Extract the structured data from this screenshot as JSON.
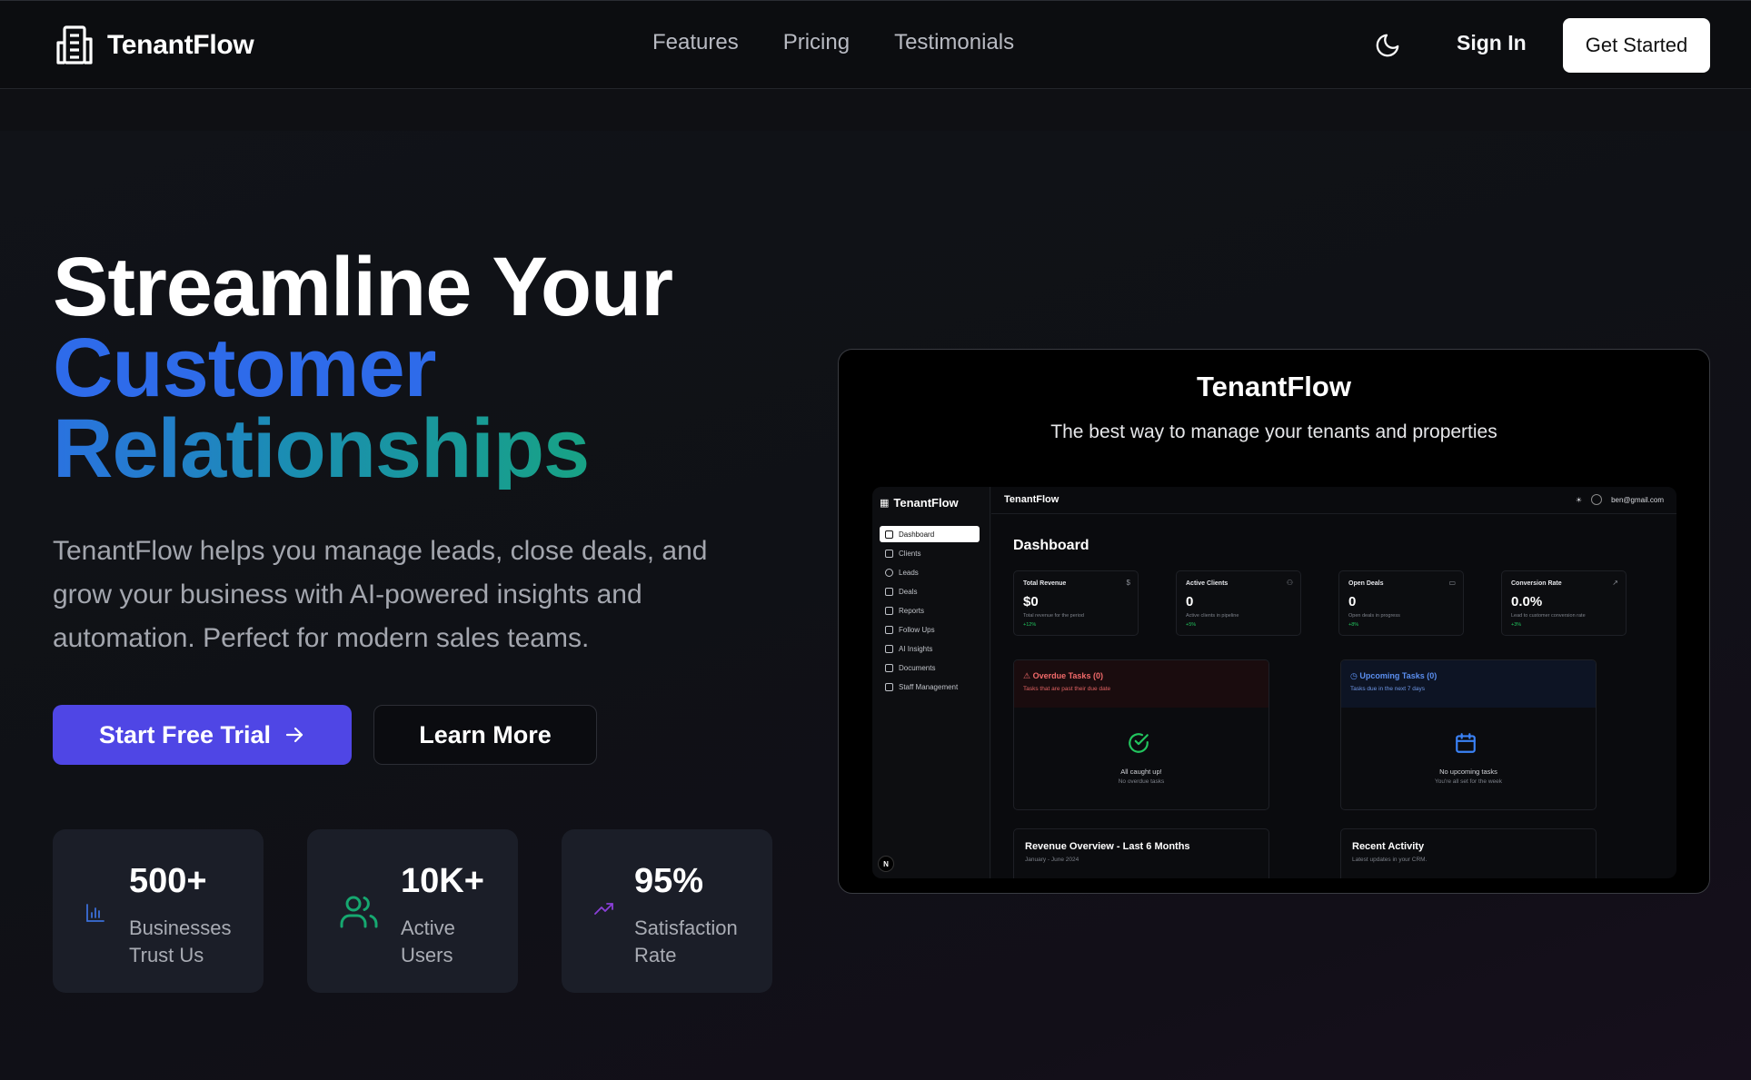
{
  "nav": {
    "brand": "TenantFlow",
    "links": [
      "Features",
      "Pricing",
      "Testimonials"
    ],
    "sign_in": "Sign In",
    "get_started": "Get Started"
  },
  "hero": {
    "headline_line1": "Streamline Your",
    "headline_line2": "Customer",
    "headline_line3": "Relationships",
    "lead": "TenantFlow helps you manage leads, close deals, and grow your business with AI-powered insights and automation. Perfect for modern sales teams.",
    "primary_cta": "Start Free Trial",
    "secondary_cta": "Learn More"
  },
  "stats": [
    {
      "value": "500+",
      "label_line1": "Businesses",
      "label_line2": "Trust Us",
      "icon": "bar-chart-icon"
    },
    {
      "value": "10K+",
      "label_line1": "Active",
      "label_line2": "Users",
      "icon": "users-icon"
    },
    {
      "value": "95%",
      "label_line1": "Satisfaction",
      "label_line2": "Rate",
      "icon": "trending-up-icon"
    }
  ],
  "preview": {
    "title": "TenantFlow",
    "subtitle": "The best way to manage your tenants and properties",
    "app": {
      "brand": "TenantFlow",
      "top_title": "TenantFlow",
      "user_email": "ben@gmail.com",
      "sidebar": [
        "Dashboard",
        "Clients",
        "Leads",
        "Deals",
        "Reports",
        "Follow Ups",
        "AI Insights",
        "Documents",
        "Staff Management"
      ],
      "page_title": "Dashboard",
      "kpis": [
        {
          "title": "Total Revenue",
          "value": "$0",
          "sub": "Total revenue for the period",
          "delta": "+12%",
          "icon": "$"
        },
        {
          "title": "Active Clients",
          "value": "0",
          "sub": "Active clients in pipeline",
          "delta": "+5%",
          "icon": "users"
        },
        {
          "title": "Open Deals",
          "value": "0",
          "sub": "Open deals in progress",
          "delta": "+8%",
          "icon": "briefcase"
        },
        {
          "title": "Conversion Rate",
          "value": "0.0%",
          "sub": "Lead to customer conversion rate",
          "delta": "+3%",
          "icon": "trend"
        }
      ],
      "overdue": {
        "title": "Overdue Tasks (0)",
        "sub": "Tasks that are past their due date",
        "msg1": "All caught up!",
        "msg2": "No overdue tasks"
      },
      "upcoming": {
        "title": "Upcoming Tasks (0)",
        "sub": "Tasks due in the next 7 days",
        "msg1": "No upcoming tasks",
        "msg2": "You're all set for the week"
      },
      "revenue": {
        "title": "Revenue Overview - Last 6 Months",
        "sub": "January - June 2024"
      },
      "activity": {
        "title": "Recent Activity",
        "sub": "Latest updates in your CRM."
      },
      "badge": "N"
    }
  },
  "colors": {
    "accent_button": "#4f46e5",
    "headline_blue": "#2e6bea",
    "headline_teal": "#17a878"
  }
}
